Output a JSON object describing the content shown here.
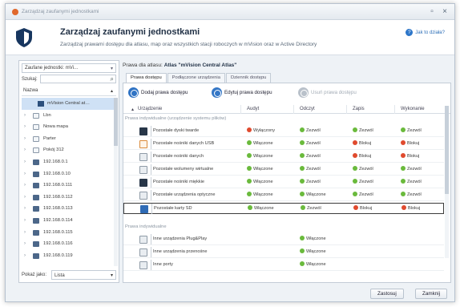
{
  "window": {
    "title": "Zarządzaj zaufanymi jednostkami",
    "minimize": "▫",
    "close": "×"
  },
  "header": {
    "title": "Zarządzaj zaufanymi jednostkami",
    "description": "Zarządzaj prawami dostępu dla atlasu, map oraz wszystkich stacji roboczych w mVision oraz w Active Directory",
    "help_label": "Jak to działa?"
  },
  "left_panel": {
    "scope_combo": "Zaufane jednostki: mVi…",
    "filter_label": "Szukaj:",
    "tree_header": "Nazwa",
    "show_as_label": "Pokaż jako:",
    "show_as_value": "Lista",
    "tree_items": [
      {
        "label": "mVision Central at…",
        "icon": "atlas-icon",
        "selected": true,
        "root": true
      },
      {
        "label": "Lbn",
        "icon": "group-icon"
      },
      {
        "label": "Nowa mapa",
        "icon": "group-icon"
      },
      {
        "label": "Parter",
        "icon": "group-icon"
      },
      {
        "label": "Pokój 312",
        "icon": "group-icon"
      },
      {
        "label": "192.168.0.1",
        "icon": "workstation-icon"
      },
      {
        "label": "192.168.0.10",
        "icon": "workstation-icon"
      },
      {
        "label": "192.168.0.111",
        "icon": "workstation-icon"
      },
      {
        "label": "192.168.0.112",
        "icon": "workstation-icon"
      },
      {
        "label": "192.168.0.113",
        "icon": "workstation-icon"
      },
      {
        "label": "192.168.0.114",
        "icon": "workstation-icon"
      },
      {
        "label": "192.168.0.115",
        "icon": "workstation-icon"
      },
      {
        "label": "192.168.0.116",
        "icon": "workstation-icon"
      },
      {
        "label": "192.168.0.119",
        "icon": "workstation-icon"
      }
    ]
  },
  "right_panel": {
    "rights_for_label": "Prawa dla atlasu:",
    "rights_for_value": "Atlas \"mVision Central Atlas\"",
    "tabs": [
      "Prawa dostępu",
      "Podłączone urządzenia",
      "Dziennik dostępu"
    ],
    "toolbar": {
      "add": "Dodaj prawa dostępu",
      "edit": "Edytuj prawa dostępu",
      "delete": "Usuń prawa dostępu"
    },
    "columns": [
      "Urządzenie",
      "Audyt",
      "Odczyt",
      "Zapis",
      "Wykonanie"
    ],
    "group1_title": "Prawa indywidualne (urządzenie systemu plików)",
    "group1_rows": [
      {
        "icon": "hard-drive-icon",
        "name": "Pozostałe dyski twarde",
        "audyt": [
          "red",
          "Wyłączony"
        ],
        "odczyt": [
          "green",
          "Zezwól"
        ],
        "zapis": [
          "green",
          "Zezwól"
        ],
        "wykonanie": [
          "green",
          "Zezwól"
        ]
      },
      {
        "icon": "usb-drive-icon",
        "name": "Pozostałe nośniki danych USB",
        "audyt": [
          "green",
          "Włączone"
        ],
        "odczyt": [
          "green",
          "Zezwól"
        ],
        "zapis": [
          "red",
          "Blokuj"
        ],
        "wykonanie": [
          "red",
          "Blokuj"
        ]
      },
      {
        "icon": "storage-icon",
        "name": "Pozostałe nośniki danych",
        "audyt": [
          "green",
          "Włączone"
        ],
        "odczyt": [
          "green",
          "Zezwól"
        ],
        "zapis": [
          "red",
          "Blokuj"
        ],
        "wykonanie": [
          "red",
          "Blokuj"
        ]
      },
      {
        "icon": "virtual-volume-icon",
        "name": "Pozostałe wolumeny wirtualne",
        "audyt": [
          "green",
          "Włączone"
        ],
        "odczyt": [
          "green",
          "Zezwól"
        ],
        "zapis": [
          "green",
          "Zezwól"
        ],
        "wykonanie": [
          "green",
          "Zezwól"
        ]
      },
      {
        "icon": "floppy-icon",
        "name": "Pozostałe nośniki miękkie",
        "audyt": [
          "green",
          "Włączone"
        ],
        "odczyt": [
          "green",
          "Zezwól"
        ],
        "zapis": [
          "green",
          "Zezwól"
        ],
        "wykonanie": [
          "green",
          "Zezwól"
        ]
      },
      {
        "icon": "optical-drive-icon",
        "name": "Pozostałe urządzenia optyczne",
        "audyt": [
          "green",
          "Włączone"
        ],
        "odczyt": [
          "green",
          "Włączone"
        ],
        "zapis": [
          "green",
          "Zezwól"
        ],
        "wykonanie": [
          "green",
          "Zezwól"
        ]
      },
      {
        "icon": "sd-card-icon",
        "name": "Pozostałe karty SD",
        "audyt": [
          "green",
          "Włączone"
        ],
        "odczyt": [
          "green",
          "Zezwól"
        ],
        "zapis": [
          "red",
          "Blokuj"
        ],
        "wykonanie": [
          "red",
          "Blokuj"
        ],
        "highlighted": true
      }
    ],
    "group2_title": "Prawa indywidualne",
    "group2_rows": [
      {
        "icon": "plug-icon",
        "name": "Inne urządzenia Plug&Play",
        "odczyt": [
          "green",
          "Włączone"
        ]
      },
      {
        "icon": "portable-device-icon",
        "name": "Inne urządzenia przenośne",
        "odczyt": [
          "green",
          "Włączone"
        ]
      },
      {
        "icon": "port-icon",
        "name": "Inne porty",
        "odczyt": [
          "green",
          "Włączone"
        ]
      }
    ]
  },
  "footer": {
    "save": "Zastosuj",
    "close": "Zamknij"
  }
}
